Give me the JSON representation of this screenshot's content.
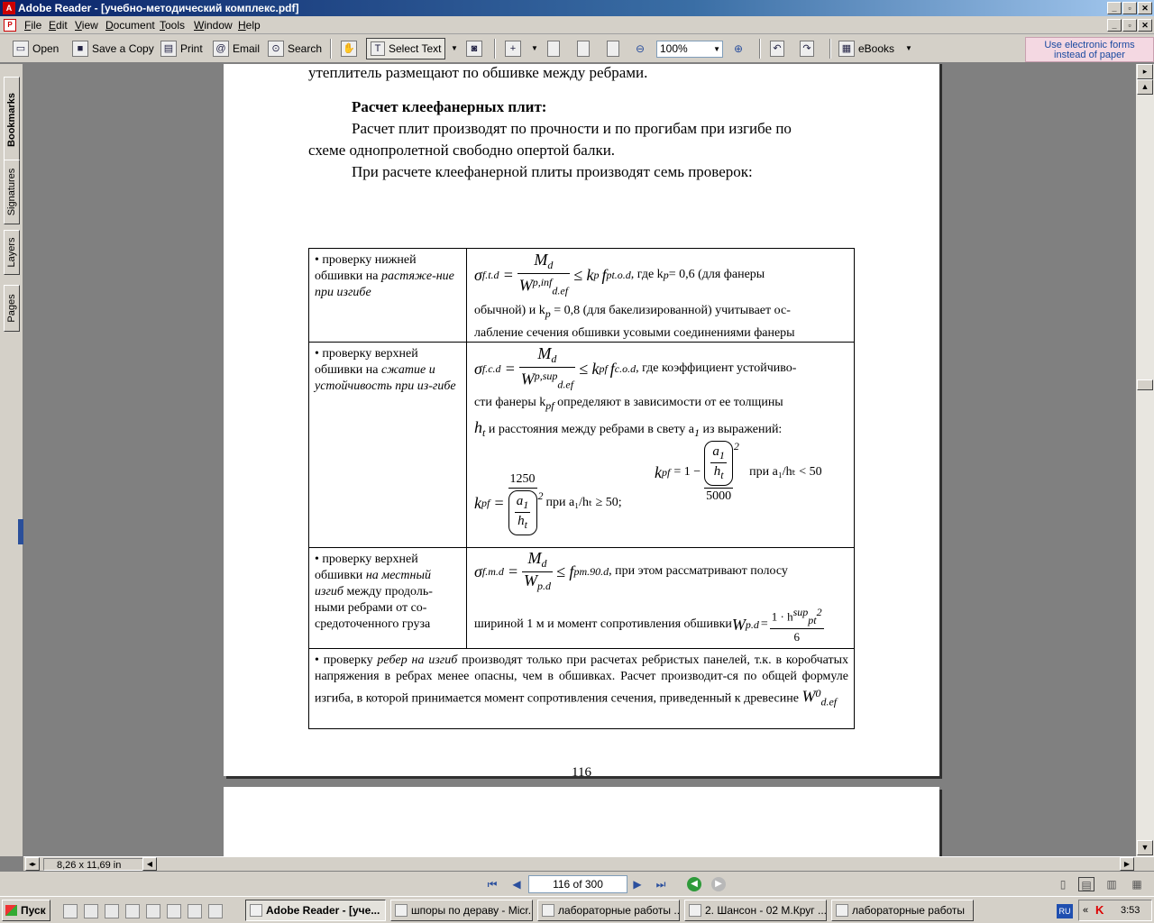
{
  "window": {
    "title": "Adobe Reader - [учебно-методический комплекс.pdf]",
    "app_icon_glyph": "A",
    "controls": [
      "_",
      "▫",
      "✕"
    ]
  },
  "menu": {
    "doc_icon_glyph": "P",
    "items": [
      "File",
      "Edit",
      "View",
      "Document",
      "Tools",
      "Window",
      "Help"
    ],
    "doc_controls": [
      "_",
      "▫",
      "✕"
    ]
  },
  "toolbar": {
    "open": "Open",
    "save_copy": "Save a Copy",
    "print": "Print",
    "email": "Email",
    "search": "Search",
    "select_text": "Select Text",
    "zoom": "100%",
    "ebooks": "eBooks",
    "promo_line1": "Use electronic forms",
    "promo_line2": "instead of paper"
  },
  "nav_tabs": [
    "Bookmarks",
    "Signatures",
    "Layers",
    "Pages"
  ],
  "document": {
    "top_cut_line": "утеплитель размещают по обшивке между ребрами.",
    "heading": "Расчет клеефанерных плит:",
    "para1_line1": "Расчет плит производят по прочности и по прогибам при изгибе по",
    "para1_line2": "схеме однопролетной свободно опертой балки.",
    "para2": "При расчете клеефанерной плиты производят семь проверок:",
    "rows": [
      {
        "left_plain": "• проверку нижней обшивки на ",
        "left_ital": "растяже-ние при изгибе",
        "formula_lhs": "σ",
        "formula_lhs_sub": "f.t.d",
        "formula_num": "M",
        "formula_num_sub": "d",
        "formula_den": "W",
        "formula_den_sup": "p,inf",
        "formula_den_sub": "d.ef",
        "formula_rhs": "≤ k",
        "formula_rhs_sub": "p",
        "formula_rhs2": "f",
        "formula_rhs2_sub": "pt.o.d",
        "text1": ",   где   k",
        "text1_sub": "p",
        "text1_rest": " = 0,6   (для фанеры",
        "text2": "обычной) и  k",
        "text2_sub": "p",
        "text2_rest": " = 0,8  (для бакелизированной) учитывает ос-",
        "text3": "лабление сечения обшивки усовыми соединениями фанеры"
      },
      {
        "left_plain": "•  проверку верхней обшивки на ",
        "left_ital": "сжатие и устойчивость при из-гибе",
        "formula_lhs": "σ",
        "formula_lhs_sub": "f.c.d",
        "formula_num": "M",
        "formula_num_sub": "d",
        "formula_den": "W",
        "formula_den_sup": "p,sup",
        "formula_den_sub": "d.ef",
        "formula_rhs": "≤ k",
        "formula_rhs_sub": "pf",
        "formula_rhs2": "f",
        "formula_rhs2_sub": "c.o.d",
        "text1": ", где коэффициент устойчиво-",
        "text2": "сти фанеры  k",
        "text2_sub": "pf",
        "text2_rest": "  определяют в зависимости от ее толщины",
        "text3_pre": "h",
        "text3_pre_sub": "t",
        "text3": "  и расстояния между ребрами в свету  a",
        "text3_sub": "1",
        "text3_rest": "  из выражений:",
        "kpf1_lhs": "k",
        "kpf1_lhs_sub": "pf",
        "kpf1_num": "1250",
        "kpf1_den_a": "a",
        "kpf1_den_a_sub": "1",
        "kpf1_den_h": "h",
        "kpf1_den_h_sub": "t",
        "kpf1_cond": "при a₁/hₜ ≥ 50;",
        "kpf2_lhs": "k",
        "kpf2_lhs_sub": "pf",
        "kpf2_eq": "= 1 −",
        "kpf2_num_a": "a",
        "kpf2_num_a_sub": "1",
        "kpf2_num_h": "h",
        "kpf2_num_h_sub": "t",
        "kpf2_den": "5000",
        "kpf2_cond": "при a₁/hₜ < 50",
        "sq": "2"
      },
      {
        "left_plain": "• проверку верхней обшивки ",
        "left_ital": "на местный изгиб",
        "left_plain2": " между продоль-ными ребрами от со-средоточенного груза",
        "formula_lhs": "σ",
        "formula_lhs_sub": "f.m.d",
        "formula_num": "M",
        "formula_num_sub": "d",
        "formula_den": "W",
        "formula_den_sub": "p.d",
        "formula_rhs": "≤ f",
        "formula_rhs_sub": "pm.90.d",
        "text1": ", при этом рассматривают полосу",
        "text2": "шириной 1 м и момент сопротивления обшивки ",
        "w_lhs": "W",
        "w_lhs_sub": "p.d",
        "w_num": "1 · h",
        "w_num_sup": "sup",
        "w_num_sub": "pt",
        "w_num_sq": "2",
        "w_den": "6"
      },
      {
        "text_plain": "• проверку ",
        "text_ital": "ребер на изгиб",
        "text_rest": " производят только при расчетах ребристых панелей, т.к. в коробчатых напряжения в ребрах менее опасны, чем в обшивках. Расчет производит-ся по общей формуле изгиба, в которой принимается момент сопротивления сечения, приведенный к древесине ",
        "w": "W",
        "w_sup": "0",
        "w_sub": "d.ef"
      }
    ],
    "page_number": "116"
  },
  "status": {
    "page_size": "8,26 x 11,69 in",
    "page_field": "116 of 300"
  },
  "taskbar": {
    "start": "Пуск",
    "tasks": [
      "Adobe Reader - [уче...",
      "шпоры по дераву - Micr...",
      "лабораторные работы ...",
      "2. Шансон - 02 М.Круг ...",
      "лабораторные работы"
    ],
    "lang": "RU",
    "clock": "3:53"
  }
}
